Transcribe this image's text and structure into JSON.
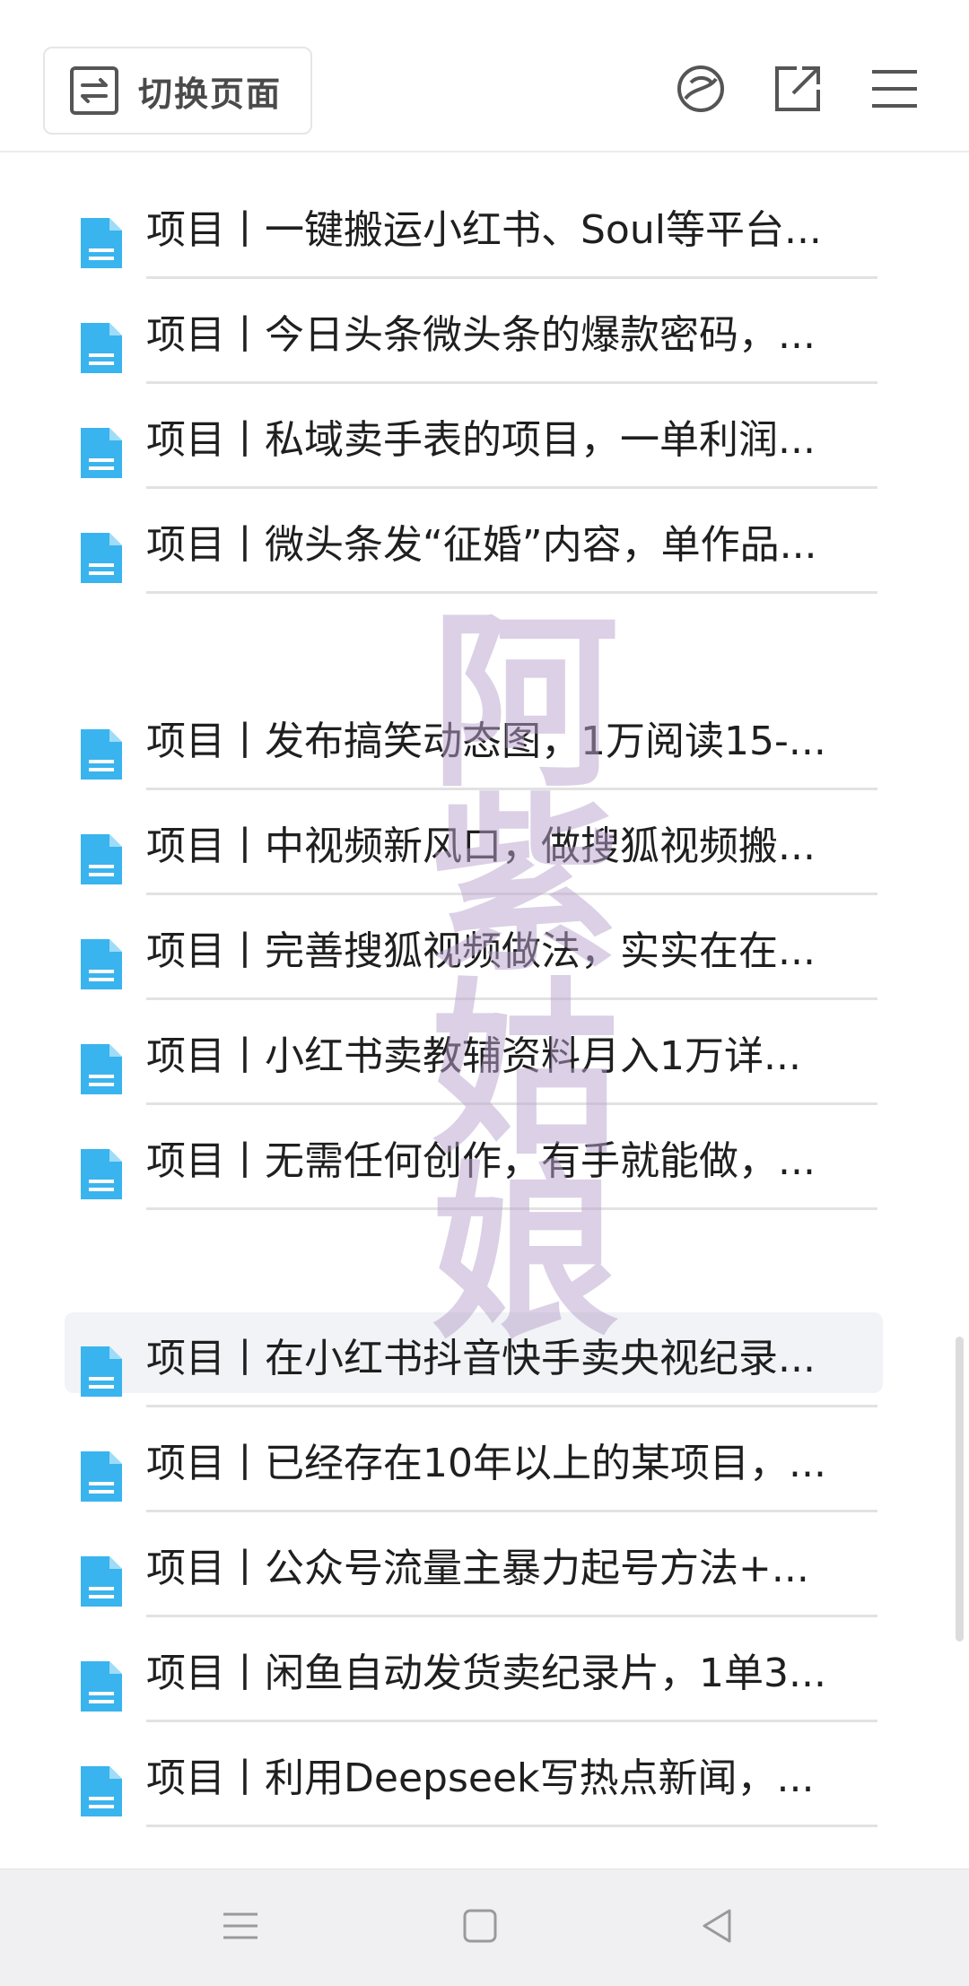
{
  "toolbar": {
    "switch_label": "切换页面",
    "icons": [
      "switch-page-icon",
      "sphere-icon",
      "open-external-icon",
      "menu-icon"
    ]
  },
  "list": {
    "items": [
      {
        "label": "项目丨一键搬运小红书、Soul等平台..."
      },
      {
        "label": "项目丨今日头条微头条的爆款密码，..."
      },
      {
        "label": "项目丨私域卖手表的项目，一单利润..."
      },
      {
        "label": "项目丨微头条发“征婚”内容，单作品..."
      },
      {
        "label": "项目丨发布搞笑动态图，1万阅读15-..."
      },
      {
        "label": "项目丨中视频新风口，做搜狐视频搬..."
      },
      {
        "label": "项目丨完善搜狐视频做法，实实在在..."
      },
      {
        "label": "项目丨小红书卖教辅资料月入1万详..."
      },
      {
        "label": "项目丨无需任何创作，有手就能做，..."
      },
      {
        "label": "项目丨在小红书抖音快手卖央视纪录..."
      },
      {
        "label": "项目丨已经存在10年以上的某项目，..."
      },
      {
        "label": "项目丨公众号流量主暴力起号方法+..."
      },
      {
        "label": "项目丨闲鱼自动发货卖纪录片，1单3..."
      },
      {
        "label": "项目丨利用Deepseek写热点新闻，..."
      }
    ]
  },
  "watermark": {
    "text": "阿紫姑娘"
  },
  "navbar": {
    "icons": [
      "menu-nav-icon",
      "home-nav-icon",
      "back-nav-icon"
    ]
  },
  "colors": {
    "doc_icon": "#3ab4ee",
    "watermark": "#b9a3cc",
    "navbar_bg": "#f0f0f2"
  }
}
